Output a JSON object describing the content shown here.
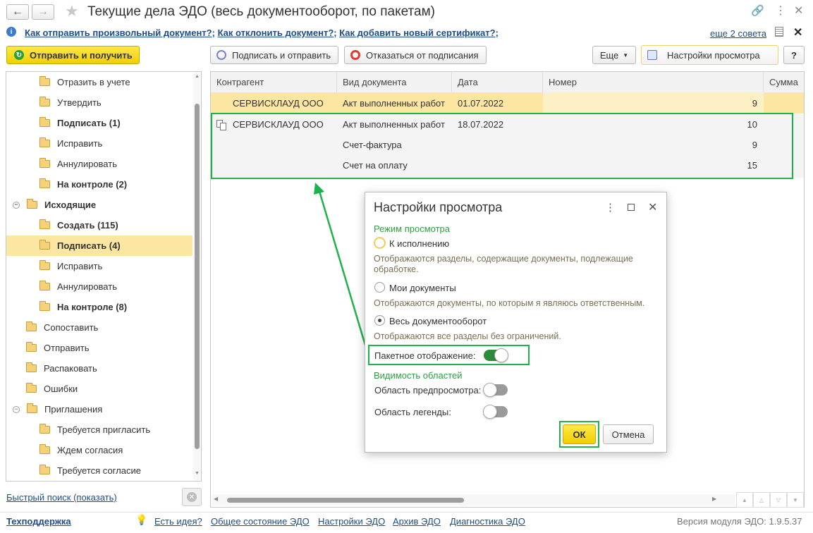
{
  "window": {
    "title": "Текущие дела ЭДО (весь документооборот, по пакетам)"
  },
  "tips": {
    "links": [
      "Как отправить произвольный документ?",
      "Как отклонить документ?",
      "Как добавить новый сертификат?"
    ],
    "more": "еще 2 совета"
  },
  "toolbar": {
    "send_receive": "Отправить и получить",
    "sign_send": "Подписать и отправить",
    "refuse_sign": "Отказаться от подписания",
    "more": "Еще",
    "view_settings": "Настройки просмотра",
    "help": "?"
  },
  "sidebar": {
    "items": [
      {
        "label": "Отразить в учете"
      },
      {
        "label": "Утвердить"
      },
      {
        "label": "Подписать (1)"
      },
      {
        "label": "Исправить"
      },
      {
        "label": "Аннулировать"
      },
      {
        "label": "На контроле (2)"
      },
      {
        "label": "Исходящие"
      },
      {
        "label": "Создать (115)"
      },
      {
        "label": "Подписать (4)"
      },
      {
        "label": "Исправить"
      },
      {
        "label": "Аннулировать"
      },
      {
        "label": "На контроле (8)"
      },
      {
        "label": "Сопоставить"
      },
      {
        "label": "Отправить"
      },
      {
        "label": "Распаковать"
      },
      {
        "label": "Ошибки"
      },
      {
        "label": "Приглашения"
      },
      {
        "label": "Требуется пригласить"
      },
      {
        "label": "Ждем согласия"
      },
      {
        "label": "Требуется согласие"
      }
    ],
    "quick_search": "Быстрый поиск (показать)"
  },
  "table": {
    "columns": [
      "Контрагент",
      "Вид документа",
      "Дата",
      "Номер",
      "Сумма"
    ],
    "rows": [
      {
        "counterparty": "СЕРВИСКЛАУД ООО",
        "doc_type": "Акт выполненных работ",
        "date": "01.07.2022",
        "number": "9"
      },
      {
        "counterparty": "СЕРВИСКЛАУД ООО",
        "doc_type": "Акт выполненных работ",
        "date": "18.07.2022",
        "number": "10"
      },
      {
        "counterparty": "",
        "doc_type": "Счет-фактура",
        "date": "",
        "number": "9"
      },
      {
        "counterparty": "",
        "doc_type": "Счет на оплату",
        "date": "",
        "number": "15"
      }
    ]
  },
  "dialog": {
    "title": "Настройки просмотра",
    "mode_heading": "Режим просмотра",
    "options": [
      {
        "label": "К исполнению",
        "hint": "Отображаются разделы, содержащие документы, подлежащие обработке."
      },
      {
        "label": "Мои документы",
        "hint": "Отображаются документы, по которым я являюсь ответственным."
      },
      {
        "label": "Весь документооборот",
        "hint": "Отображаются все разделы без ограничений."
      }
    ],
    "hint_line1": "Отображаются разделы, содержащие документы, подлежащие",
    "hint_line2": "обработке.",
    "batch_label": "Пакетное отображение:",
    "visibility_heading": "Видимость областей",
    "preview_label": "Область предпросмотра:",
    "legend_label": "Область легенды:",
    "ok": "ОК",
    "cancel": "Отмена"
  },
  "footer": {
    "support": "Техподдержка",
    "links": [
      "Есть идея?",
      "Общее состояние ЭДО",
      "Настройки ЭДО",
      "Архив ЭДО",
      "Диагностика ЭДО"
    ],
    "version": "Версия модуля ЭДО: 1.9.5.37"
  },
  "colors": {
    "accent_yellow": "#f5d400",
    "selection": "#fbe7a1",
    "highlight_green": "#1db34a",
    "toggle_on": "#2e8b3c",
    "link": "#1c4c8c"
  }
}
